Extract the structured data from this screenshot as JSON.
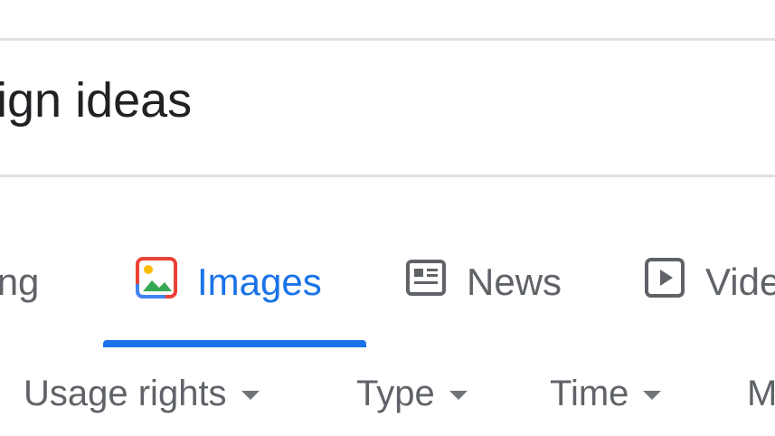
{
  "search": {
    "query_visible": "ign ideas"
  },
  "tabs": [
    {
      "label": "ping",
      "icon": "none"
    },
    {
      "label": "Images",
      "icon": "image-icon",
      "active": true
    },
    {
      "label": "News",
      "icon": "news-icon"
    },
    {
      "label": "Vide",
      "icon": "video-icon"
    }
  ],
  "filters": [
    {
      "label": "Usage rights"
    },
    {
      "label": "Type"
    },
    {
      "label": "Time"
    },
    {
      "label": "M"
    }
  ],
  "colors": {
    "accent": "#1a73e8",
    "text_primary": "#202124",
    "text_secondary": "#5f6368",
    "divider": "#dfe1e5"
  }
}
